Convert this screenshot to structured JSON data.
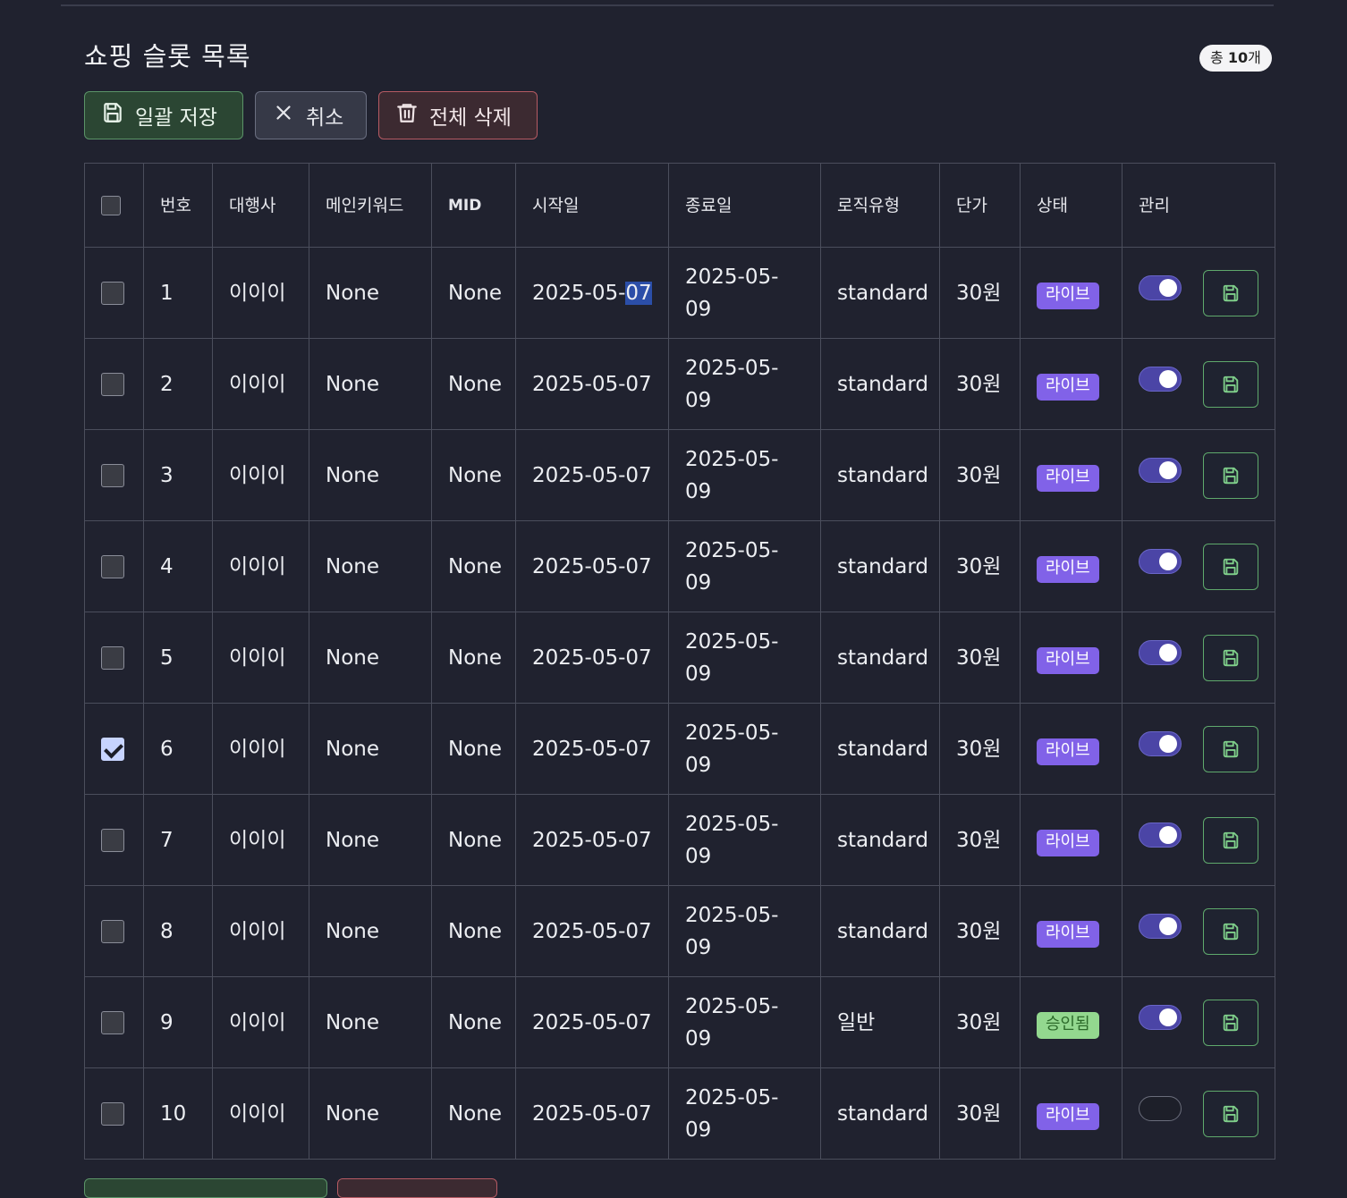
{
  "page": {
    "title": "쇼핑 슬롯 목록",
    "count_prefix": "총",
    "count_value": "10",
    "count_suffix": "개"
  },
  "toolbar": {
    "bulk_save_label": "일괄 저장",
    "cancel_label": "취소",
    "delete_all_label": "전체 삭제"
  },
  "table": {
    "headers": {
      "no": "번호",
      "agency": "대행사",
      "main_keyword": "메인키워드",
      "mid": "MID",
      "start_date": "시작일",
      "end_date": "종료일",
      "logic_type": "로직유형",
      "unit_price": "단가",
      "status": "상태",
      "manage": "관리"
    },
    "rows": [
      {
        "no": "1",
        "agency": "이이이",
        "keyword": "None",
        "mid": "None",
        "start": "2025-05-07",
        "end": "2025-05-09",
        "logic": "standard",
        "price": "30원",
        "status": "라이브",
        "status_kind": "live",
        "active": true,
        "checked": false
      },
      {
        "no": "2",
        "agency": "이이이",
        "keyword": "None",
        "mid": "None",
        "start": "2025-05-07",
        "end": "2025-05-09",
        "logic": "standard",
        "price": "30원",
        "status": "라이브",
        "status_kind": "live",
        "active": true,
        "checked": false
      },
      {
        "no": "3",
        "agency": "이이이",
        "keyword": "None",
        "mid": "None",
        "start": "2025-05-07",
        "end": "2025-05-09",
        "logic": "standard",
        "price": "30원",
        "status": "라이브",
        "status_kind": "live",
        "active": true,
        "checked": false
      },
      {
        "no": "4",
        "agency": "이이이",
        "keyword": "None",
        "mid": "None",
        "start": "2025-05-07",
        "end": "2025-05-09",
        "logic": "standard",
        "price": "30원",
        "status": "라이브",
        "status_kind": "live",
        "active": true,
        "checked": false
      },
      {
        "no": "5",
        "agency": "이이이",
        "keyword": "None",
        "mid": "None",
        "start": "2025-05-07",
        "end": "2025-05-09",
        "logic": "standard",
        "price": "30원",
        "status": "라이브",
        "status_kind": "live",
        "active": true,
        "checked": false
      },
      {
        "no": "6",
        "agency": "이이이",
        "keyword": "None",
        "mid": "None",
        "start": "2025-05-07",
        "end": "2025-05-09",
        "logic": "standard",
        "price": "30원",
        "status": "라이브",
        "status_kind": "live",
        "active": true,
        "checked": true
      },
      {
        "no": "7",
        "agency": "이이이",
        "keyword": "None",
        "mid": "None",
        "start": "2025-05-07",
        "end": "2025-05-09",
        "logic": "standard",
        "price": "30원",
        "status": "라이브",
        "status_kind": "live",
        "active": true,
        "checked": false
      },
      {
        "no": "8",
        "agency": "이이이",
        "keyword": "None",
        "mid": "None",
        "start": "2025-05-07",
        "end": "2025-05-09",
        "logic": "standard",
        "price": "30원",
        "status": "라이브",
        "status_kind": "live",
        "active": true,
        "checked": false
      },
      {
        "no": "9",
        "agency": "이이이",
        "keyword": "None",
        "mid": "None",
        "start": "2025-05-07",
        "end": "2025-05-09",
        "logic": "일반",
        "price": "30원",
        "status": "승인됨",
        "status_kind": "approved",
        "active": true,
        "checked": false
      },
      {
        "no": "10",
        "agency": "이이이",
        "keyword": "None",
        "mid": "None",
        "start": "2025-05-07",
        "end": "2025-05-09",
        "logic": "standard",
        "price": "30원",
        "status": "라이브",
        "status_kind": "live",
        "active": false,
        "checked": false
      }
    ]
  },
  "icons": {
    "save": "floppy-disk-icon",
    "cancel": "x-icon",
    "delete": "trash-icon"
  },
  "colors": {
    "live_badge": "#8162e8",
    "approved_badge": "#93d88f",
    "save_accent": "#5b9468",
    "delete_accent": "#b55a63",
    "toggle_on": "#4b45a6"
  }
}
